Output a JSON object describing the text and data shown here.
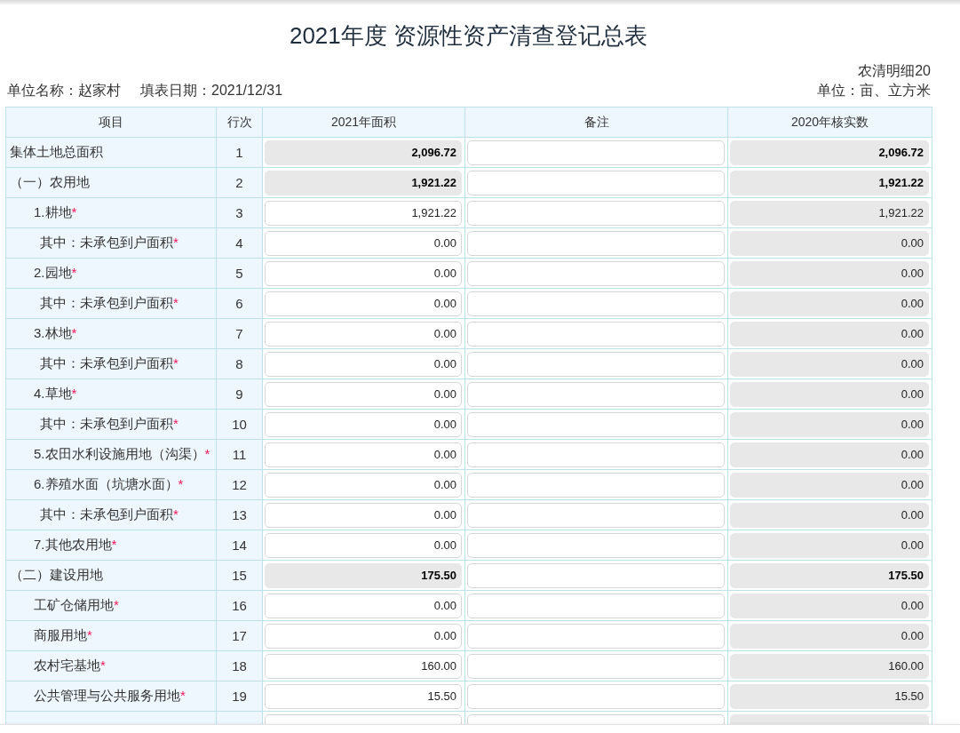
{
  "page": {
    "title": "2021年度 资源性资产清查登记总表"
  },
  "meta": {
    "unit_label": "单位名称：",
    "unit_name": "赵家村",
    "date_label": "填表日期：",
    "date": "2021/12/31",
    "form_code": "农清明细20",
    "measure": "单位：亩、立方米"
  },
  "table": {
    "columns": [
      "项目",
      "行次",
      "2021年面积",
      "备注",
      "2020年核实数"
    ],
    "rows": [
      {
        "label": "集体土地总面积",
        "line": "1",
        "area": "2,096.72",
        "area_locked": true,
        "prior": "2,096.72",
        "prior_locked": true,
        "subtotal": true,
        "children": [
          {
            "label": "（一）农用地",
            "line": "2",
            "area": "1,921.22",
            "area_locked": true,
            "prior": "1,921.22",
            "prior_locked": true,
            "subtotal": true,
            "children": [
              {
                "label": "1.耕地",
                "required_mark": "*",
                "line": "3",
                "area": "1,921.22",
                "area_locked": false,
                "prior": "1,921.22",
                "prior_locked": true,
                "subtotal": false,
                "children": [
                  {
                    "label": "其中：未承包到户面积",
                    "required_mark": "*",
                    "line": "4",
                    "area": "0.00",
                    "area_locked": false,
                    "prior": "0.00",
                    "prior_locked": true,
                    "subtotal": false
                  }
                ]
              },
              {
                "label": "2.园地",
                "required_mark": "*",
                "line": "5",
                "area": "0.00",
                "area_locked": false,
                "prior": "0.00",
                "prior_locked": true,
                "subtotal": false,
                "children": [
                  {
                    "label": "其中：未承包到户面积",
                    "required_mark": "*",
                    "line": "6",
                    "area": "0.00",
                    "area_locked": false,
                    "prior": "0.00",
                    "prior_locked": true,
                    "subtotal": false
                  }
                ]
              },
              {
                "label": "3.林地",
                "required_mark": "*",
                "line": "7",
                "area": "0.00",
                "area_locked": false,
                "prior": "0.00",
                "prior_locked": true,
                "subtotal": false,
                "children": [
                  {
                    "label": "其中：未承包到户面积",
                    "required_mark": "*",
                    "line": "8",
                    "area": "0.00",
                    "area_locked": false,
                    "prior": "0.00",
                    "prior_locked": true,
                    "subtotal": false
                  }
                ]
              },
              {
                "label": "4.草地",
                "required_mark": "*",
                "line": "9",
                "area": "0.00",
                "area_locked": false,
                "prior": "0.00",
                "prior_locked": true,
                "subtotal": false,
                "children": [
                  {
                    "label": "其中：未承包到户面积",
                    "required_mark": "*",
                    "line": "10",
                    "area": "0.00",
                    "area_locked": false,
                    "prior": "0.00",
                    "prior_locked": true,
                    "subtotal": false
                  }
                ]
              },
              {
                "label": "5.农田水利设施用地（沟渠）",
                "required_mark": "*",
                "line": "11",
                "area": "0.00",
                "area_locked": false,
                "prior": "0.00",
                "prior_locked": true,
                "subtotal": false
              },
              {
                "label": "6.养殖水面（坑塘水面）",
                "required_mark": "*",
                "line": "12",
                "area": "0.00",
                "area_locked": false,
                "prior": "0.00",
                "prior_locked": true,
                "subtotal": false,
                "children": [
                  {
                    "label": "其中：未承包到户面积",
                    "required_mark": "*",
                    "line": "13",
                    "area": "0.00",
                    "area_locked": false,
                    "prior": "0.00",
                    "prior_locked": true,
                    "subtotal": false
                  }
                ]
              },
              {
                "label": "7.其他农用地",
                "required_mark": "*",
                "line": "14",
                "area": "0.00",
                "area_locked": false,
                "prior": "0.00",
                "prior_locked": true,
                "subtotal": false
              }
            ]
          },
          {
            "label": "（二）建设用地",
            "line": "15",
            "area": "175.50",
            "area_locked": true,
            "prior": "175.50",
            "prior_locked": true,
            "subtotal": true,
            "children": [
              {
                "label": "工矿仓储用地",
                "required_mark": "*",
                "line": "16",
                "area": "0.00",
                "area_locked": false,
                "prior": "0.00",
                "prior_locked": true,
                "subtotal": false
              },
              {
                "label": "商服用地",
                "required_mark": "*",
                "line": "17",
                "area": "0.00",
                "area_locked": false,
                "prior": "0.00",
                "prior_locked": true,
                "subtotal": false
              },
              {
                "label": "农村宅基地",
                "required_mark": "*",
                "line": "18",
                "area": "160.00",
                "area_locked": false,
                "prior": "160.00",
                "prior_locked": true,
                "subtotal": false
              },
              {
                "label": "公共管理与公共服务用地",
                "required_mark": "*",
                "line": "19",
                "area": "15.50",
                "area_locked": false,
                "prior": "15.50",
                "prior_locked": true,
                "subtotal": false
              }
            ]
          }
        ]
      }
    ],
    "clipped_row": {
      "area_locked": false,
      "prior_locked": true
    }
  }
}
